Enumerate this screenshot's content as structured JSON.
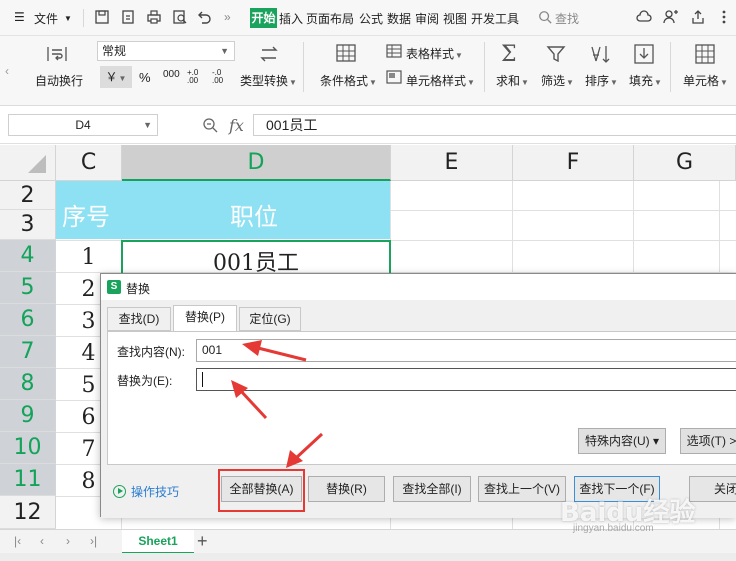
{
  "menubar": {
    "file_menu": "文件",
    "tabs": [
      "开始",
      "插入",
      "页面布局",
      "公式",
      "数据",
      "审阅",
      "视图",
      "开发工具"
    ],
    "search_label": "查找",
    "more": "»"
  },
  "ribbon": {
    "wrap_text": "自动换行",
    "number_format": "常规",
    "currency": "￥",
    "percent": "%",
    "thousands": "000",
    "dec_inc": "+.0 .00",
    "dec_dec": "-.0 .00",
    "type_convert": "类型转换",
    "cond_format": "条件格式",
    "table_style": "表格样式",
    "cell_style": "单元格样式",
    "sum": "求和",
    "filter": "筛选",
    "sort": "排序",
    "fill": "填充",
    "cell": "单元格"
  },
  "formula_bar": {
    "cell_ref": "D4",
    "fx": "fx",
    "content": "001员工"
  },
  "grid": {
    "columns": [
      "C",
      "D",
      "E",
      "F",
      "G"
    ],
    "rows": [
      "2",
      "3",
      "4",
      "5",
      "6",
      "7",
      "8",
      "9",
      "10",
      "11",
      "12"
    ],
    "header_seq": "序号",
    "header_position": "职位",
    "seq_values": [
      "1",
      "2",
      "3",
      "4",
      "5",
      "6",
      "7",
      "8"
    ],
    "d4_value": "001员工"
  },
  "sheets": {
    "active": "Sheet1",
    "add": "+"
  },
  "dialog": {
    "title": "替换",
    "logo": "S",
    "tabs": [
      "查找(D)",
      "替换(P)",
      "定位(G)"
    ],
    "find_label": "查找内容(N):",
    "find_value": "001",
    "replace_label": "替换为(E):",
    "replace_value": "",
    "special_content": "特殊内容(U)",
    "options": "选项(T) >>",
    "tips": "操作技巧",
    "buttons": {
      "replace_all": "全部替换(A)",
      "replace": "替换(R)",
      "find_all": "查找全部(I)",
      "find_prev": "查找上一个(V)",
      "find_next": "查找下一个(F)",
      "close": "关闭"
    }
  },
  "watermark": {
    "brand": "Baidu经验",
    "url": "jingyan.baidu.com"
  },
  "colors": {
    "accent": "#1aa35c",
    "header_fill": "#8de1f3",
    "annotation": "#e53935"
  }
}
